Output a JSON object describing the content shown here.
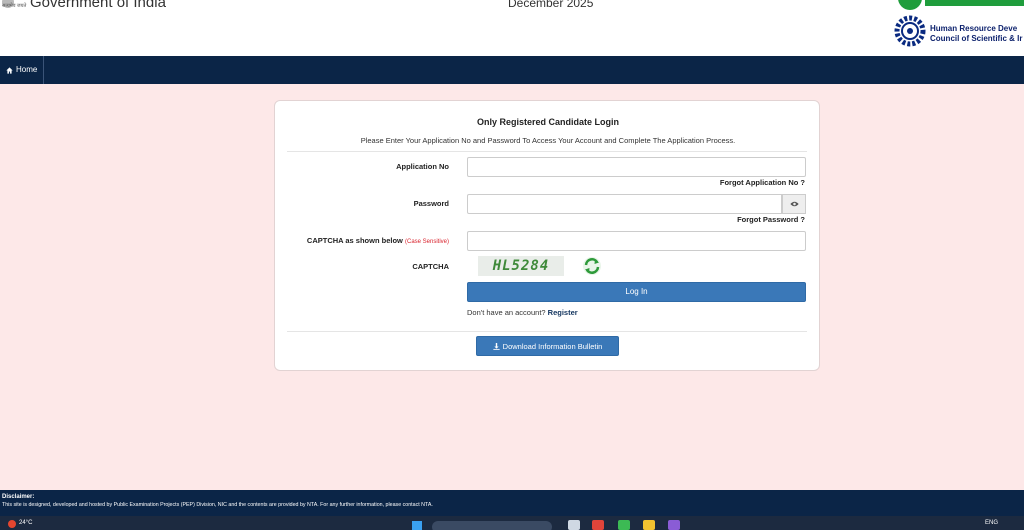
{
  "header": {
    "gov_title": "Government of India",
    "gov_hindi": "सत्यमेव जयते",
    "session": "December 2025",
    "org_line1": "Human Resource Deve",
    "org_line2": "Council of Scientific & Ir"
  },
  "nav": {
    "home_label": "Home"
  },
  "login": {
    "title": "Only Registered Candidate Login",
    "subtitle": "Please Enter Your Application No and Password To Access Your Account and Complete The Application Process.",
    "application_no_label": "Application No",
    "application_no_value": "",
    "forgot_application_no": "Forgot Application No ?",
    "password_label": "Password",
    "password_value": "",
    "forgot_password": "Forgot Password ?",
    "captcha_input_label": "CAPTCHA as shown below",
    "case_sensitive_note": "(Case Sensitive)",
    "captcha_input_value": "",
    "captcha_label": "CAPTCHA",
    "captcha_code": "HL5284",
    "login_button": "Log In",
    "no_account_text": "Don't have an account?",
    "register_link": "Register",
    "download_button": "Download Information Bulletin"
  },
  "footer": {
    "disclaimer_title": "Disclaimer:",
    "disclaimer_text": "This site is designed, developed and hosted by Public Examination Projects (PEP) Division, NIC and the contents are provided by NTA. For any further information, please contact NTA."
  },
  "taskbar": {
    "temperature": "24°C",
    "language": "ENG"
  },
  "colors": {
    "page_bg": "#fde8e8",
    "nav_bg": "#0b2547",
    "button_blue": "#3a78b8",
    "warning_red": "#d9232d"
  }
}
